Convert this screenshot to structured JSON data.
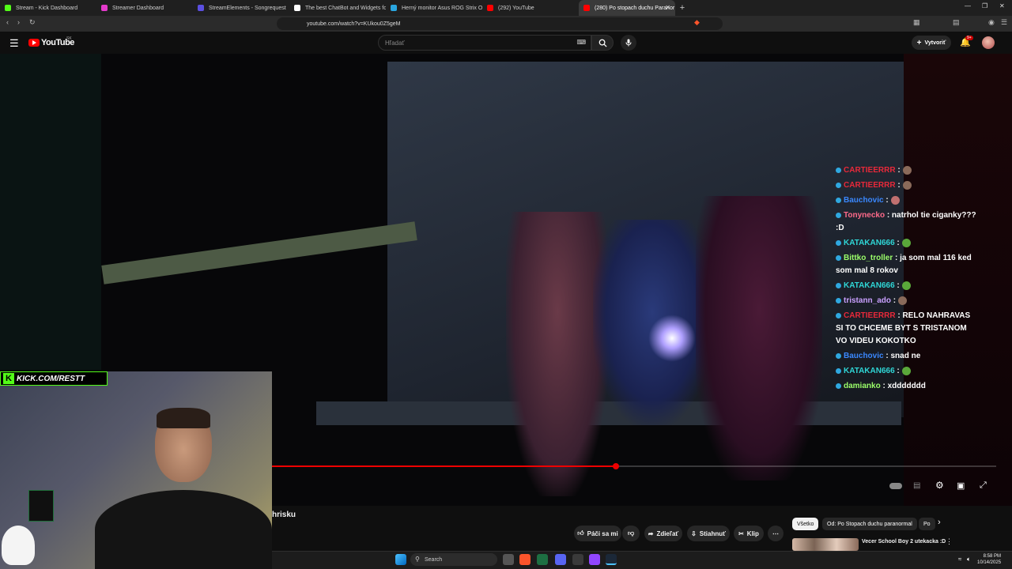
{
  "browser": {
    "tabs": [
      {
        "label": "Stream - Kick Dashboard",
        "color": "#53fc18"
      },
      {
        "label": "Streamer Dashboard",
        "color": "#e43acb"
      },
      {
        "label": "StreamElements - Songrequest",
        "color": "#5b4fe0"
      },
      {
        "label": "The best ChatBot and Widgets for Ki",
        "color": "#ffffff"
      },
      {
        "label": "Herný monitor Asus ROG Strix OLED",
        "color": "#2aa6e0"
      },
      {
        "label": "(292) YouTube",
        "color": "#ff0000"
      },
      {
        "label": "(280) Po stopach duchu Paranor",
        "color": "#ff0000",
        "active": true
      }
    ],
    "url": "youtube.com/watch?v=KUkou0Z5geM"
  },
  "youtube": {
    "logo_text": "YouTube",
    "logo_region": "SK",
    "search_placeholder": "Hľadať",
    "create_label": "Vytvoriť",
    "notif_count": "9+",
    "accent": "#ff0000"
  },
  "chat": [
    {
      "user": "CARTIEERRR",
      "color": "#e8293a",
      "text": ":",
      "emote": "#8a6a5a"
    },
    {
      "user": "CARTIEERRR",
      "color": "#e8293a",
      "text": ":",
      "emote": "#8a6a5a"
    },
    {
      "user": "Bauchovic",
      "color": "#3a88ff",
      "text": ":",
      "emote": "#c07070"
    },
    {
      "user": "Tonynecko",
      "color": "#ff6a8a",
      "text": ": natrhol tie ciganky??? :D"
    },
    {
      "user": "KATAKAN666",
      "color": "#2fd6d6",
      "text": ":",
      "emote": "#5aa83a"
    },
    {
      "user": "Bittko_troller",
      "color": "#9bff6a",
      "text": ": ja som mal 116 ked som mal 8 rokov"
    },
    {
      "user": "KATAKAN666",
      "color": "#2fd6d6",
      "text": ":",
      "emote": "#5aa83a"
    },
    {
      "user": "tristann_ado",
      "color": "#c9a0ff",
      "text": ":",
      "emote": "#8a6a5a"
    },
    {
      "user": "CARTIEERRR",
      "color": "#e8293a",
      "text": ": RELO NAHRAVAS SI TO CHCEME BYT S TRISTANOM VO VIDEU KOKOTKO"
    },
    {
      "user": "Bauchovic",
      "color": "#3a88ff",
      "text": ": snad ne"
    },
    {
      "user": "KATAKAN666",
      "color": "#2fd6d6",
      "text": ":",
      "emote": "#5aa83a"
    },
    {
      "user": "damianko",
      "color": "#9bff6a",
      "text": ": xddddddd"
    }
  ],
  "video": {
    "progress": 0.475
  },
  "overlay": {
    "kick_text": "KICK.COM/RESTT"
  },
  "below": {
    "title_fragment": "hrisku",
    "actions": {
      "like": "Páči sa mi",
      "share": "Zdieľať",
      "download": "Stiahnuť",
      "clip": "Klip"
    },
    "chips": [
      "Všetko",
      "Od: Po Stopach duchu paranormal",
      "Po"
    ],
    "rec_title": "Vecer School Boy 2 utekacka :D"
  },
  "taskbar": {
    "search_label": "Search",
    "time": "8:58 PM",
    "date": "10/14/2025"
  }
}
